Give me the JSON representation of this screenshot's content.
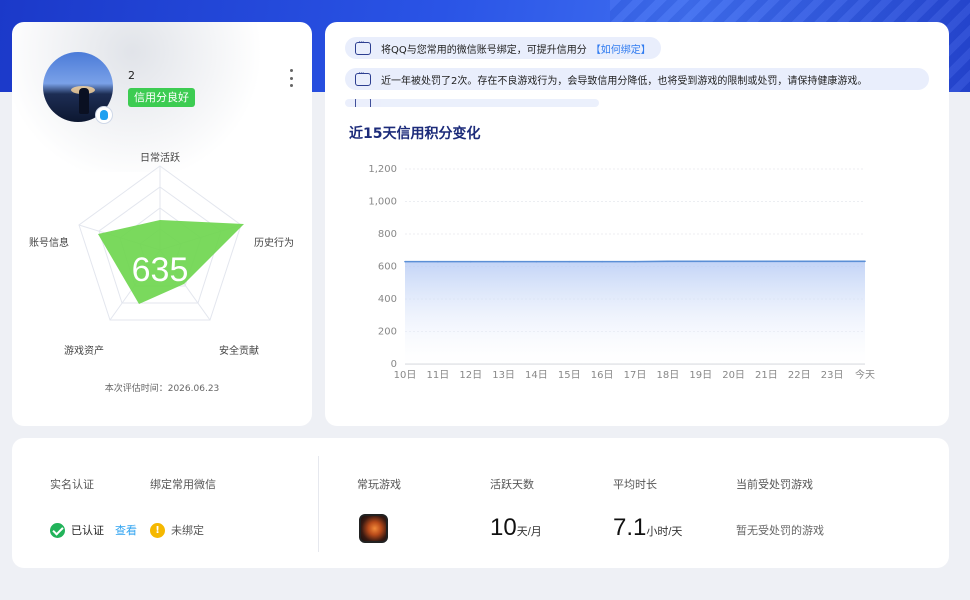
{
  "profile": {
    "username": "2",
    "credit_badge": "信用分良好",
    "score": "635",
    "radar_axes": [
      "日常活跃",
      "历史行为",
      "安全贡献",
      "游戏资产",
      "账号信息"
    ],
    "eval_time": "本次评估时间：2026.06.23"
  },
  "notices": {
    "n1_text": "将QQ与您常用的微信账号绑定，可提升信用分",
    "n1_link": "【如何绑定】",
    "n2_text": "近一年被处罚了2次。存在不良游戏行为，会导致信用分降低，也将受到游戏的限制或处罚，请保持健康游戏。"
  },
  "chart_data": {
    "type": "area",
    "title": "近15天信用积分变化",
    "categories": [
      "10日",
      "11日",
      "12日",
      "13日",
      "14日",
      "15日",
      "16日",
      "17日",
      "18日",
      "19日",
      "20日",
      "21日",
      "22日",
      "23日",
      "今天"
    ],
    "values": [
      630,
      630,
      630,
      630,
      630,
      630,
      630,
      630,
      632,
      632,
      632,
      632,
      632,
      632,
      632
    ],
    "ylim": [
      0,
      1200
    ],
    "yticks": [
      "0",
      "200",
      "400",
      "600",
      "800",
      "1,000",
      "1,200"
    ],
    "line_color": "#5b8fd6"
  },
  "info": {
    "realname_label": "实名认证",
    "realname_status": "已认证",
    "realname_view": "查看",
    "wechat_label": "绑定常用微信",
    "wechat_status": "未绑定",
    "games_label": "常玩游戏",
    "active_days_label": "活跃天数",
    "active_days_value": "10",
    "active_days_unit": "天/月",
    "avg_time_label": "平均时长",
    "avg_time_value": "7.1",
    "avg_time_unit": "小时/天",
    "penalty_label": "当前受处罚游戏",
    "penalty_status": "暂无受处罚的游戏"
  }
}
